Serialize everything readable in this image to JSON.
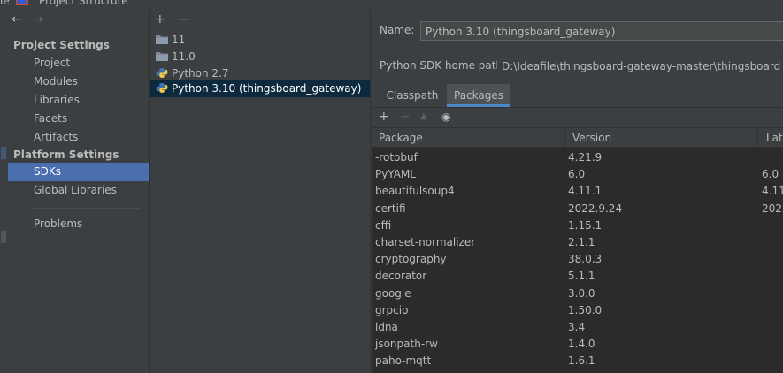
{
  "window": {
    "title": "Project Structure",
    "left_edge_text": "le"
  },
  "nav": {
    "sections": [
      {
        "heading": "Project Settings",
        "items": [
          "Project",
          "Modules",
          "Libraries",
          "Facets",
          "Artifacts"
        ]
      },
      {
        "heading": "Platform Settings",
        "items": [
          "SDKs",
          "Global Libraries"
        ]
      }
    ],
    "extra_items": [
      "Problems"
    ],
    "selected": "SDKs"
  },
  "sdk_list": {
    "toolbar": [
      "+",
      "−"
    ],
    "items": [
      {
        "label": "11",
        "icon": "folder-icon"
      },
      {
        "label": "11.0",
        "icon": "folder-icon"
      },
      {
        "label": "Python 2.7",
        "icon": "python-icon"
      },
      {
        "label": "Python 3.10 (thingsboard_gateway)",
        "icon": "python-icon",
        "selected": true
      }
    ]
  },
  "details": {
    "name_label": "Name:",
    "name_value": "Python 3.10 (thingsboard_gateway)",
    "home_label": "Python SDK home path:",
    "home_value": "D:\\Ideafile\\thingsboard-gateway-master\\thingsboard_gatew",
    "tabs": [
      "Classpath",
      "Packages"
    ],
    "active_tab": "Packages",
    "toolbar": [
      "+",
      "−",
      "▲",
      "◉"
    ]
  },
  "packages": {
    "columns": [
      "Package",
      "Version",
      "Late"
    ],
    "rows": [
      [
        "-rotobuf",
        "4.21.9",
        ""
      ],
      [
        "PyYAML",
        "6.0",
        "6.0"
      ],
      [
        "beautifulsoup4",
        "4.11.1",
        "4.11"
      ],
      [
        "certifi",
        "2022.9.24",
        "2022"
      ],
      [
        "cffi",
        "1.15.1",
        ""
      ],
      [
        "charset-normalizer",
        "2.1.1",
        ""
      ],
      [
        "cryptography",
        "38.0.3",
        ""
      ],
      [
        "decorator",
        "5.1.1",
        ""
      ],
      [
        "google",
        "3.0.0",
        ""
      ],
      [
        "grpcio",
        "1.50.0",
        ""
      ],
      [
        "idna",
        "3.4",
        ""
      ],
      [
        "jsonpath-rw",
        "1.4.0",
        ""
      ],
      [
        "paho-mqtt",
        "1.6.1",
        ""
      ]
    ]
  },
  "colors": {
    "bg": "#3c3f41",
    "table_bg": "#2b2b2b",
    "selection": "#4b6eaf",
    "list_selection": "#0d293e",
    "text": "#bbbbbb",
    "accent_add": "#6a9955",
    "accent_tab": "#4a88c7"
  }
}
